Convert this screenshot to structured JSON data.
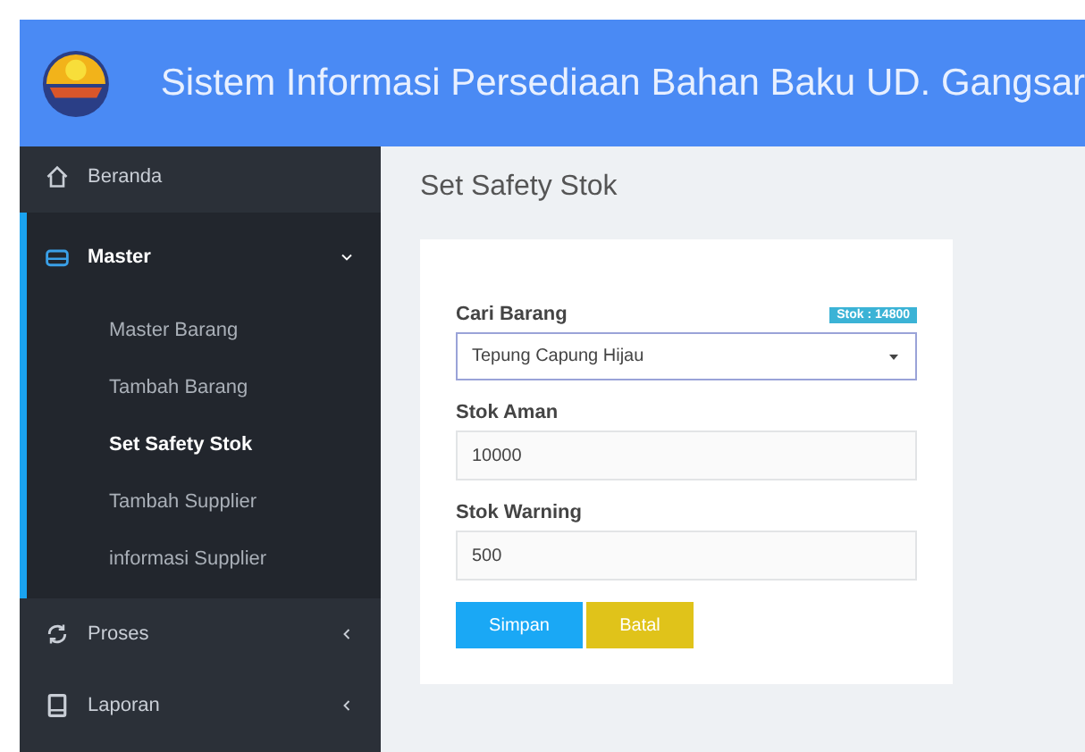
{
  "header": {
    "title": "Sistem Informasi Persediaan Bahan Baku UD. Gangsar"
  },
  "sidebar": {
    "items": [
      {
        "label": "Beranda",
        "selected": false
      },
      {
        "label": "Master",
        "selected": true,
        "expanded": true,
        "children": [
          {
            "label": "Master Barang",
            "selected": false
          },
          {
            "label": "Tambah Barang",
            "selected": false
          },
          {
            "label": "Set Safety Stok",
            "selected": true
          },
          {
            "label": "Tambah Supplier",
            "selected": false
          },
          {
            "label": "informasi Supplier",
            "selected": false
          }
        ]
      },
      {
        "label": "Proses",
        "selected": false,
        "expanded": false
      },
      {
        "label": "Laporan",
        "selected": false,
        "expanded": false
      }
    ]
  },
  "page": {
    "title": "Set Safety Stok"
  },
  "form": {
    "fields": [
      {
        "kind": "select",
        "label": "Cari Barang",
        "badge": "Stok : 14800",
        "value": "Tepung Capung Hijau"
      },
      {
        "kind": "input",
        "label": "Stok Aman",
        "value": "10000"
      },
      {
        "kind": "input",
        "label": "Stok Warning",
        "value": "500"
      }
    ],
    "buttons": [
      {
        "kind": "primary",
        "label": "Simpan"
      },
      {
        "kind": "warning",
        "label": "Batal"
      }
    ]
  }
}
